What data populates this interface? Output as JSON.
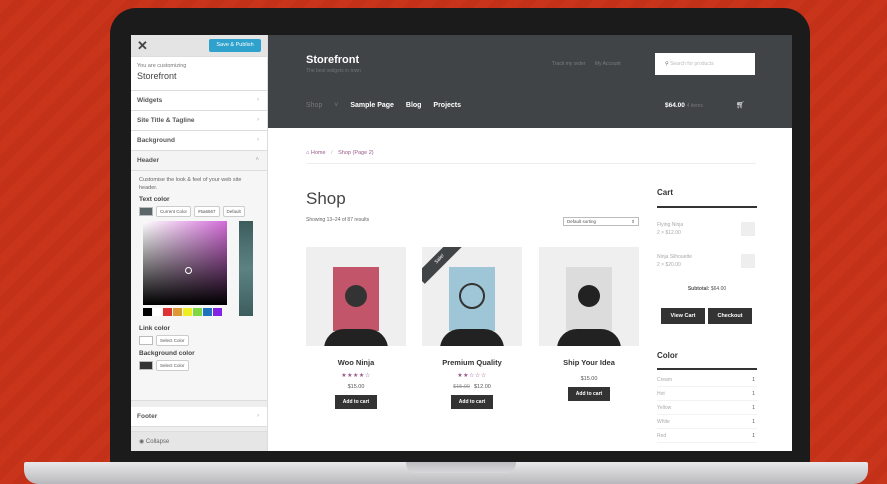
{
  "customizer": {
    "save_label": "Save & Publish",
    "close_icon": "close-icon",
    "customizing_label": "You are customizing",
    "theme_name": "Storefront",
    "sections": [
      "Widgets",
      "Site Title & Tagline",
      "Background",
      "Header"
    ],
    "header_desc": "Customise the look & feel of your web site header.",
    "text_color_label": "Text color",
    "current_color_label": "Current Color",
    "text_color_hex": "#5a6567",
    "default_label": "Default",
    "link_color_label": "Link color",
    "background_color_label": "Background color",
    "select_color_label": "Select Color",
    "footer_label": "Footer",
    "collapse_label": "Collapse",
    "palette": [
      "#000000",
      "#ffffff",
      "#dd3333",
      "#dd9933",
      "#eeee22",
      "#81d742",
      "#1e73be",
      "#8224e3"
    ]
  },
  "site": {
    "title": "Storefront",
    "tagline": "The best widgets in town",
    "secondary_nav": [
      "Track my order",
      "My Account"
    ],
    "search_placeholder": "Search for products",
    "nav": [
      "Shop",
      "Sample Page",
      "Blog",
      "Projects"
    ],
    "cart_total": "$64.00",
    "cart_items": "4 items",
    "breadcrumb": {
      "home": "Home",
      "current": "Shop (Page 2)"
    },
    "page_title": "Shop",
    "results": "Showing 13–24 of 87 results",
    "sorting": "Default sorting"
  },
  "products": [
    {
      "title": "Woo Ninja",
      "stars": "★★★★☆",
      "price": "$15.00",
      "old_price": "",
      "button": "Add to cart",
      "sale": ""
    },
    {
      "title": "Premium Quality",
      "stars": "★★☆☆☆",
      "price": "$12.00",
      "old_price": "$15.00",
      "button": "Add to cart",
      "sale": "Sale!"
    },
    {
      "title": "Ship Your Idea",
      "stars": "",
      "price": "$15.00",
      "old_price": "",
      "button": "Add to cart",
      "sale": ""
    }
  ],
  "cart_widget": {
    "title": "Cart",
    "items": [
      {
        "name": "Flying Ninja",
        "qty": "2 × $12.00"
      },
      {
        "name": "Ninja Silhouette",
        "qty": "2 × $20.00"
      }
    ],
    "subtotal_label": "Subtotal:",
    "subtotal": "$64.00",
    "view_cart": "View Cart",
    "checkout": "Checkout"
  },
  "color_widget": {
    "title": "Color",
    "rows": [
      {
        "name": "Cream",
        "count": "1"
      },
      {
        "name": "Hot",
        "count": "1"
      },
      {
        "name": "Yellow",
        "count": "1"
      },
      {
        "name": "White",
        "count": "1"
      },
      {
        "name": "Red",
        "count": "1"
      }
    ]
  },
  "colors": {
    "accent": "#96588a",
    "header_bg": "#404446",
    "button": "#2ea2cc"
  }
}
